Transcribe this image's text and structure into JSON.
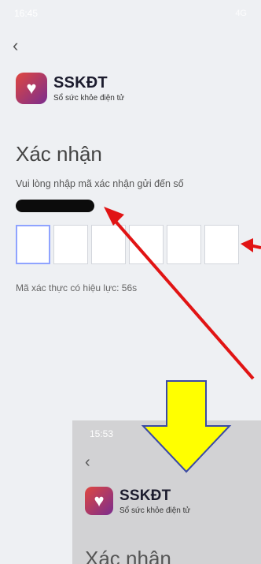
{
  "status_time": "16:45",
  "status_icons": "4G",
  "back_icon": "chevron-left-icon",
  "brand": {
    "title": "SSKĐT",
    "subtitle": "Sổ sức khỏe điện tử",
    "logo_icon": "heart-logo-icon"
  },
  "heading": "Xác nhận",
  "hint": "Vui lòng nhập mã xác nhận gửi đến số",
  "otp_boxes": 6,
  "validity": "Mã xác thực có hiệu lực: 56s",
  "inset": {
    "status_time": "15:53",
    "back_icon": "chevron-left-icon",
    "brand_title": "SSKĐT",
    "brand_subtitle": "Sổ sức khỏe điện tử",
    "heading_partial": "Xác nhận"
  },
  "colors": {
    "arrow_red": "#e11414",
    "arrow_yellow": "#ffff00",
    "active_box": "#8fa3ff"
  }
}
